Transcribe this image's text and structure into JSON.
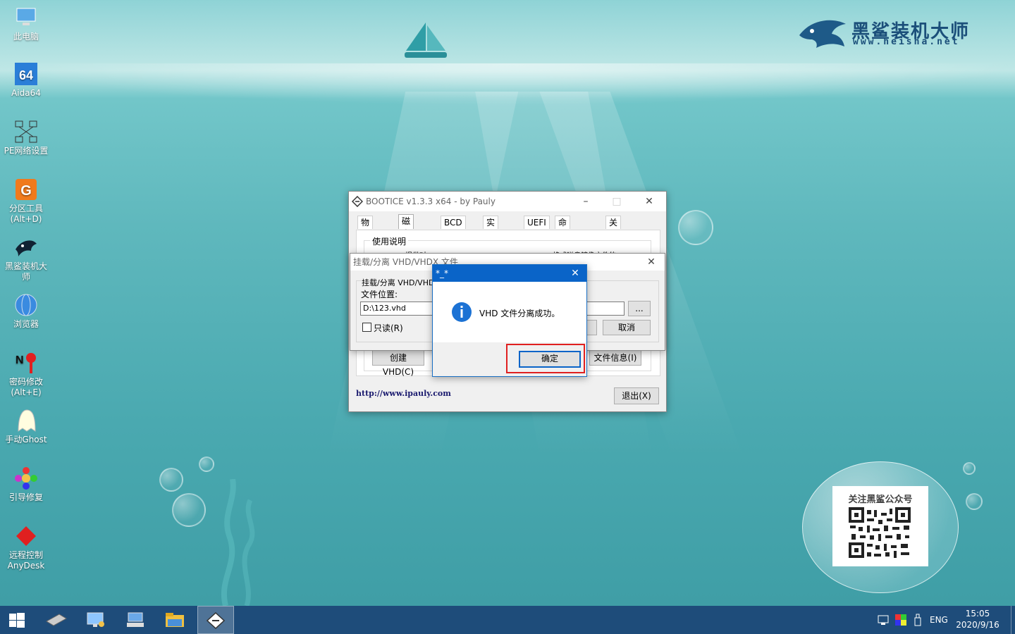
{
  "desktop_icons": [
    {
      "label": "此电脑",
      "icon": "computer-icon"
    },
    {
      "label": "Aida64",
      "icon": "aida64-icon"
    },
    {
      "label": "PE网络设置",
      "icon": "network-icon"
    },
    {
      "label": "分区工具\n(Alt+D)",
      "icon": "partition-tool-icon"
    },
    {
      "label": "黑鲨装机大\n师",
      "icon": "heisha-shark-icon"
    },
    {
      "label": "浏览器",
      "icon": "browser-globe-icon"
    },
    {
      "label": "密码修改\n(Alt+E)",
      "icon": "password-key-icon"
    },
    {
      "label": "手动Ghost",
      "icon": "ghost-icon"
    },
    {
      "label": "引导修复",
      "icon": "boot-repair-icon"
    },
    {
      "label": "远程控制\nAnyDesk",
      "icon": "anydesk-icon"
    }
  ],
  "logo": {
    "title": "黑鲨装机大师",
    "url": "www.heisha.net"
  },
  "qr": {
    "title": "关注黑鲨公众号"
  },
  "bootice": {
    "title": "BOOTICE v1.3.3 x64 - by Pauly",
    "tabs": [
      "物理磁盘",
      "磁盘镜像",
      "BCD 编辑",
      "实用工具",
      "UEFI",
      "命令行参数",
      "关于"
    ],
    "active_tab": "磁盘镜像",
    "group_label": "使用说明",
    "group_text": "BOOTICE 提供对 *.IMG/*.IMA/*.VHD/*.VHDX/*.VMDK 格式磁盘镜像文件的",
    "create_vhd": "创建 VHD(C)",
    "file_info": "文件信息(I)",
    "link": "http://www.ipauly.com",
    "exit": "退出(X)"
  },
  "mount_dialog": {
    "title": "挂载/分离 VHD/VHDX 文件",
    "section": "挂载/分离 VHD/VHDX",
    "file_label": "文件位置:",
    "file_value": "D:\\123.vhd",
    "browse": "...",
    "readonly": "只读(R)",
    "cancel": "取消"
  },
  "msgbox": {
    "title": "*_*",
    "message": "VHD 文件分离成功。",
    "ok": "确定"
  },
  "taskbar": {
    "lang": "ENG",
    "time": "15:05",
    "date": "2020/9/16"
  },
  "colors": {
    "highlight": "#e02020",
    "taskbar": "#1e4c7a",
    "msg_title": "#0a64c8"
  }
}
